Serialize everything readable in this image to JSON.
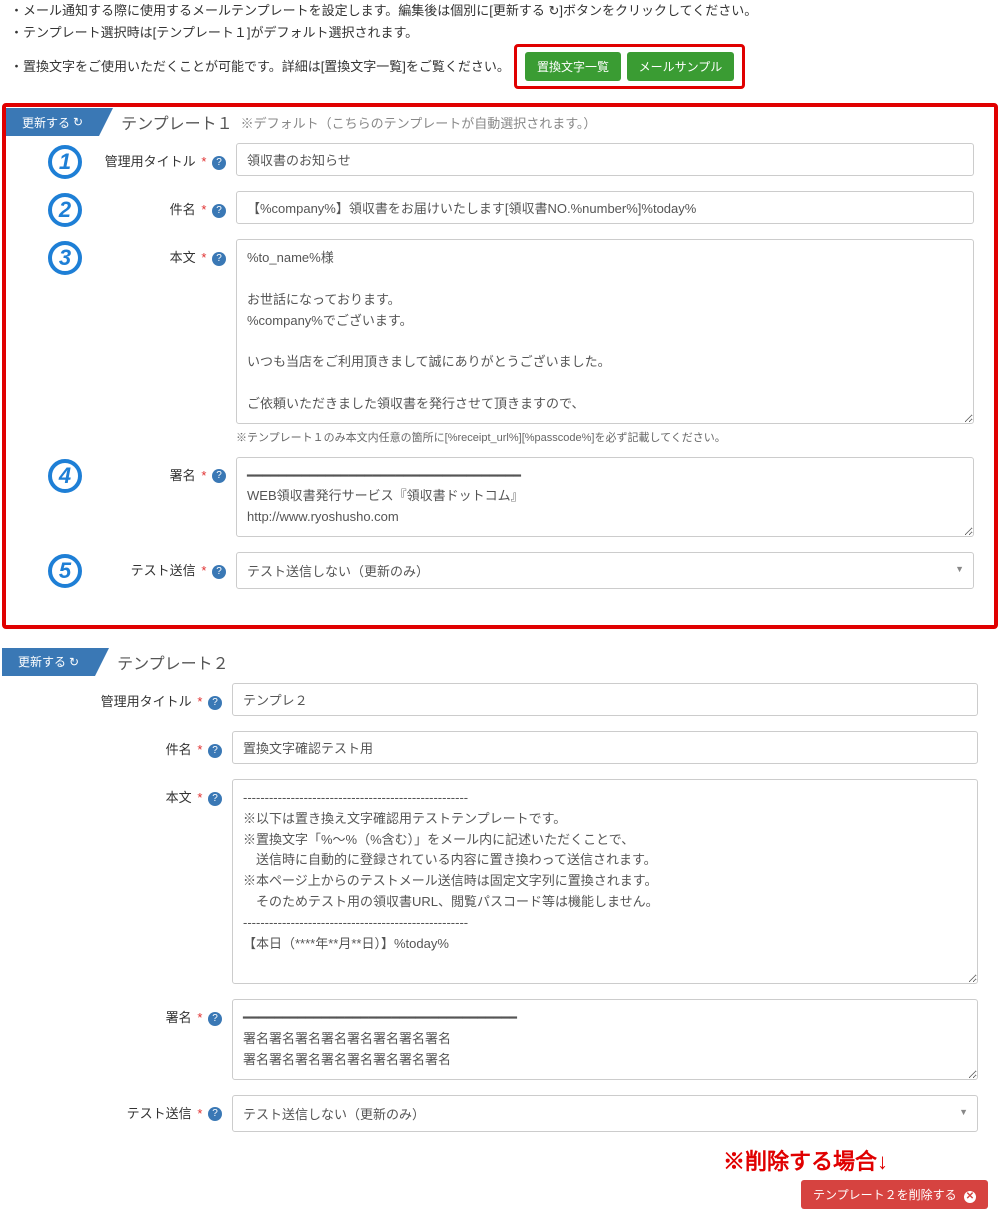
{
  "intro": {
    "line1": "・メール通知する際に使用するメールテンプレートを設定します。編集後は個別に[更新する ↻]ボタンをクリックしてください。",
    "line2": "・テンプレート選択時は[テンプレート１]がデフォルト選択されます。",
    "line3": "・置換文字をご使用いただくことが可能です。詳細は[置換文字一覧]をご覧ください。",
    "btn_replace_list": "置換文字一覧",
    "btn_mail_sample": "メールサンプル"
  },
  "common": {
    "update_label": "更新する",
    "required_mark": "*",
    "help_mark": "?",
    "labels": {
      "admin_title": "管理用タイトル",
      "subject": "件名",
      "body": "本文",
      "signature": "署名",
      "test_send": "テスト送信"
    },
    "test_send_value": "テスト送信しない（更新のみ）"
  },
  "template1": {
    "header_title": "テンプレート１",
    "header_note": "※デフォルト（こちらのテンプレートが自動選択されます。）",
    "admin_title": "領収書のお知らせ",
    "subject": "【%company%】領収書をお届けいたします[領収書NO.%number%]%today%",
    "body": "%to_name%様\n\nお世話になっております。\n%company%でございます。\n\nいつも当店をご利用頂きまして誠にありがとうございました。\n\nご依頼いただきました領収書を発行させて頂きますので、",
    "body_hint": "※テンプレート１のみ本文内任意の箇所に[%receipt_url%][%passcode%]を必ず記載してください。",
    "signature": "━━━━━━━━━━━━━━━━━━━━━━━━━━━━━━━━━━━\nWEB領収書発行サービス『領収書ドットコム』\nhttp://www.ryoshusho.com"
  },
  "template2": {
    "header_title": "テンプレート２",
    "admin_title": "テンプレ２",
    "subject": "置換文字確認テスト用",
    "body": "----------------------------------------------------\n※以下は置き換え文字確認用テストテンプレートです。\n※置換文字「%～%（%含む）」をメール内に記述いただくことで、\n　送信時に自動的に登録されている内容に置き換わって送信されます。\n※本ページ上からのテストメール送信時は固定文字列に置換されます。\n　そのためテスト用の領収書URL、閲覧パスコード等は機能しません。\n----------------------------------------------------\n【本日（****年**月**日）】%today%",
    "signature": "━━━━━━━━━━━━━━━━━━━━━━━━━━━━━━━━━━━\n署名署名署名署名署名署名署名署名\n署名署名署名署名署名署名署名署名",
    "delete_note": "※削除する場合↓",
    "delete_btn": "テンプレート２を削除する"
  }
}
